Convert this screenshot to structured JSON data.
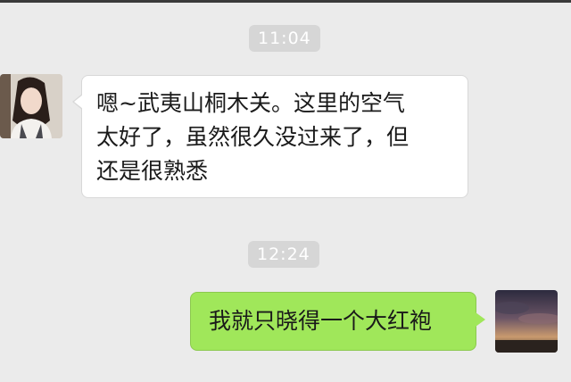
{
  "chat": {
    "messages": [
      {
        "timestamp": "11:04",
        "sender": "other",
        "lines": [
          "嗯~武夷山桐木关。这里的空气",
          "太好了，虽然很久没过来了，但",
          "还是很熟悉"
        ]
      },
      {
        "timestamp": "12:24",
        "sender": "self",
        "lines": [
          "我就只晓得一个大红袍"
        ]
      }
    ]
  },
  "colors": {
    "background": "#ebebeb",
    "incoming_bubble": "#ffffff",
    "outgoing_bubble": "#a0e75a",
    "timestamp_pill": "#d6d6d6"
  },
  "icons": {
    "left_avatar": "woman-portrait-avatar",
    "right_avatar": "sunset-sky-avatar"
  }
}
